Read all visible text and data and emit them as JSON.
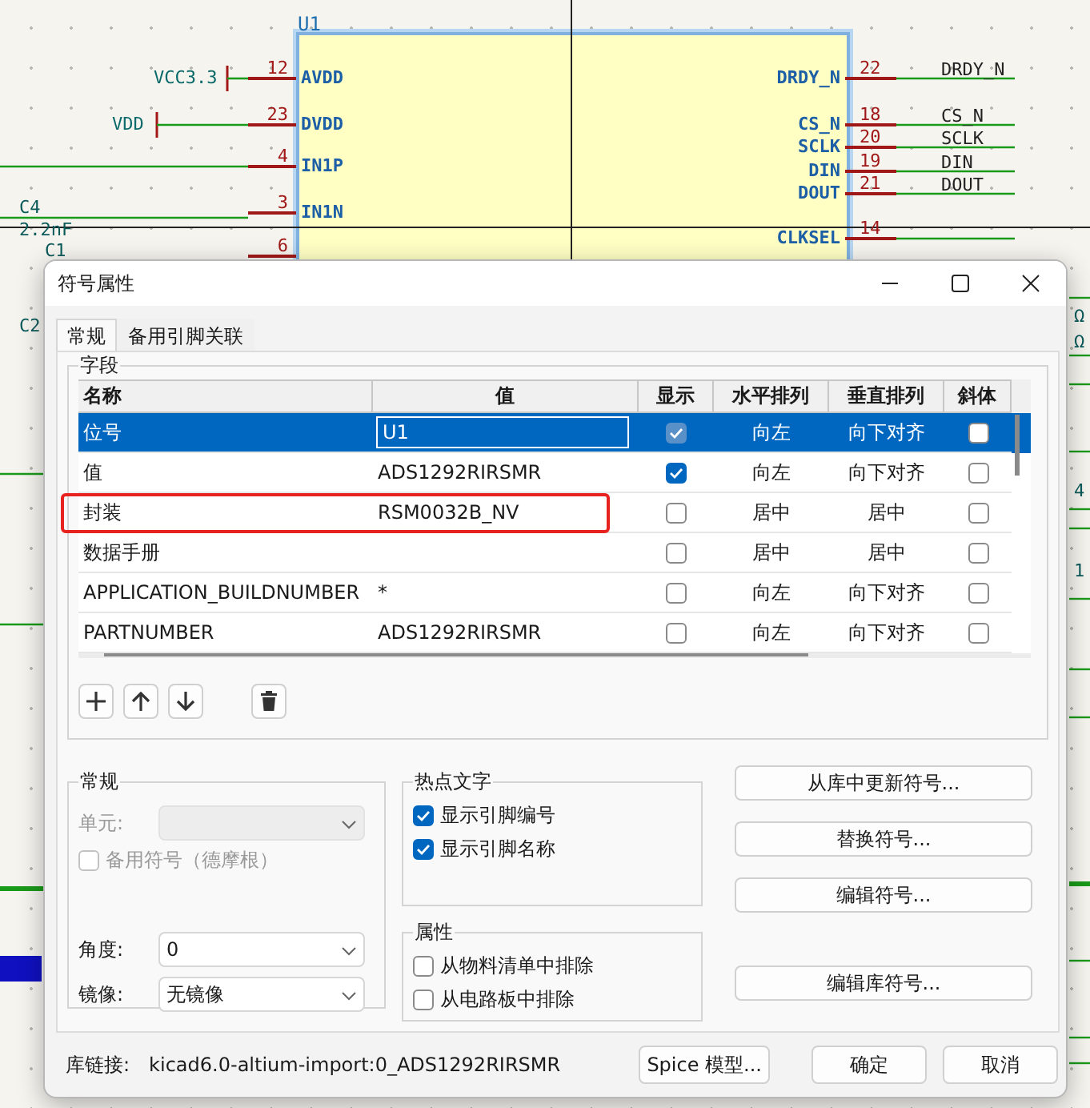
{
  "schematic": {
    "reference": "U1",
    "left_pins": [
      {
        "number": "12",
        "name": "AVDD"
      },
      {
        "number": "23",
        "name": "DVDD"
      },
      {
        "number": "4",
        "name": "IN1P"
      },
      {
        "number": "3",
        "name": "IN1N"
      },
      {
        "number": "6"
      }
    ],
    "right_pins": [
      {
        "number": "22",
        "name": "DRDY_N"
      },
      {
        "number": "18",
        "name": "CS_N"
      },
      {
        "number": "20",
        "name": "SCLK"
      },
      {
        "number": "19",
        "name": "DIN"
      },
      {
        "number": "21",
        "name": "DOUT"
      },
      {
        "number": "14",
        "name": "CLKSEL"
      }
    ],
    "power_labels": [
      "VCC3.3",
      "VDD"
    ],
    "net_labels": [
      "DRDY_N",
      "CS_N",
      "SCLK",
      "DIN",
      "DOUT"
    ],
    "part_labels": [
      "C4",
      "2.2nF",
      "C1",
      "C2",
      "Ω",
      "Ω",
      "4",
      "1"
    ]
  },
  "dialog": {
    "title": "符号属性",
    "tabs": [
      {
        "label": "常规",
        "selected": true
      },
      {
        "label": "备用引脚关联",
        "selected": false
      }
    ],
    "fields_group": "字段",
    "columns": [
      "名称",
      "值",
      "显示",
      "水平排列",
      "垂直排列",
      "斜体"
    ],
    "rows": [
      {
        "name": "位号",
        "value": "U1",
        "show": true,
        "h_align": "向左",
        "v_align": "向下对齐",
        "italic": false,
        "selected": true,
        "highlighted": false
      },
      {
        "name": "值",
        "value": "ADS1292RIRSMR",
        "show": true,
        "h_align": "向左",
        "v_align": "向下对齐",
        "italic": false,
        "selected": false,
        "highlighted": false
      },
      {
        "name": "封装",
        "value": "RSM0032B_NV",
        "show": false,
        "h_align": "居中",
        "v_align": "居中",
        "italic": false,
        "selected": false,
        "highlighted": true
      },
      {
        "name": "数据手册",
        "show": false,
        "h_align": "居中",
        "v_align": "居中",
        "italic": false,
        "selected": false,
        "highlighted": false
      },
      {
        "name": "APPLICATION_BUILDNUMBER",
        "value": "*",
        "show": false,
        "h_align": "向左",
        "v_align": "向下对齐",
        "italic": false,
        "selected": false,
        "highlighted": false
      },
      {
        "name": "PARTNUMBER",
        "value": "ADS1292RIRSMR",
        "show": false,
        "h_align": "向左",
        "v_align": "向下对齐",
        "italic": false,
        "selected": false,
        "highlighted": false
      }
    ],
    "general": {
      "title": "常规",
      "unit": {
        "label": "单元:",
        "disabled": true
      },
      "demorgan": {
        "label": "备用符号（德摩根）",
        "checked": false,
        "disabled": true
      },
      "angle": {
        "label": "角度:",
        "value": "0"
      },
      "mirror": {
        "label": "镜像:",
        "value": "无镜像"
      }
    },
    "hotspot": {
      "title": "热点文字",
      "options": [
        {
          "label": "显示引脚编号",
          "checked": true
        },
        {
          "label": "显示引脚名称",
          "checked": true
        }
      ]
    },
    "attributes": {
      "title": "属性",
      "options": [
        {
          "label": "从物料清单中排除",
          "checked": false
        },
        {
          "label": "从电路板中排除",
          "checked": false
        }
      ]
    },
    "side_buttons": [
      "从库中更新符号...",
      "替换符号...",
      "编辑符号...",
      "编辑库符号..."
    ],
    "library_link": {
      "label": "库链接:",
      "value": "kicad6.0-altium-import:0_ADS1292RIRSMR"
    },
    "footer_buttons": [
      "Spice 模型...",
      "确定",
      "取消"
    ]
  }
}
